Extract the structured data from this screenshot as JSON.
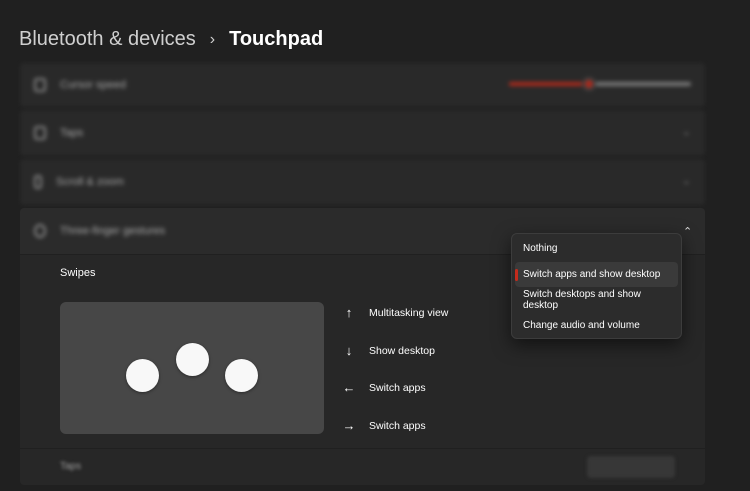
{
  "breadcrumb": {
    "parent": "Bluetooth & devices",
    "separator": "›",
    "current": "Touchpad"
  },
  "rows": {
    "cursor_speed": {
      "label": "Cursor speed",
      "slider_value_fraction": 0.44
    },
    "taps": {
      "label": "Taps"
    },
    "scroll_zoom": {
      "label": "Scroll & zoom"
    },
    "three_finger": {
      "label": "Three-finger gestures"
    }
  },
  "swipes": {
    "label": "Swipes",
    "gestures": [
      {
        "arrow": "↑",
        "label": "Multitasking view"
      },
      {
        "arrow": "↓",
        "label": "Show desktop"
      },
      {
        "arrow": "←",
        "label": "Switch apps"
      },
      {
        "arrow": "→",
        "label": "Switch apps"
      }
    ]
  },
  "dropdown": {
    "options": [
      "Nothing",
      "Switch apps and show desktop",
      "Switch desktops and show desktop",
      "Change audio and volume"
    ],
    "selected": "Switch apps and show desktop"
  },
  "taps_row": {
    "label": "Taps"
  },
  "colors": {
    "accent": "#c42b1c",
    "background": "#202020",
    "card": "#2b2b2b"
  },
  "icons": {
    "expand": "chevron-down-icon",
    "collapse": "chevron-up-icon"
  }
}
